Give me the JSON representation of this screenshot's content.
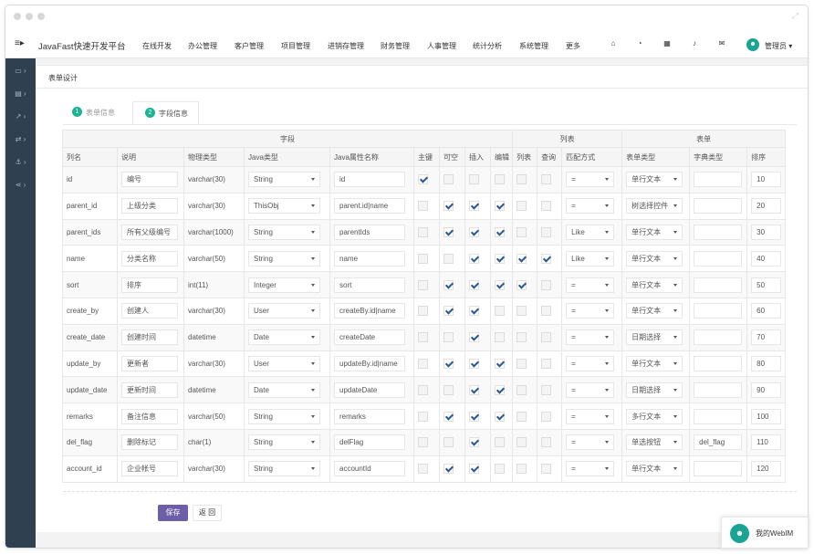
{
  "nav": {
    "brand": "JavaFast快速开发平台",
    "items": [
      "在线开发",
      "办公管理",
      "客户管理",
      "项目管理",
      "进销存管理",
      "财务管理",
      "人事管理",
      "统计分析",
      "系统管理",
      "更多"
    ],
    "icons": [
      "home-icon",
      "dashboard-icon",
      "calendar-icon",
      "bell-icon",
      "mail-icon"
    ],
    "user": "管理员 ▾",
    "user_avatar": "☻"
  },
  "sidebar": {
    "icons": [
      "monitor-icon",
      "document-icon",
      "chart-icon",
      "exchange-icon",
      "anchor-icon",
      "share-icon"
    ]
  },
  "page": {
    "title": "表单设计",
    "tabs": [
      {
        "num": "1",
        "label": "表单信息"
      },
      {
        "num": "2",
        "label": "字段信息"
      }
    ],
    "save_label": "保存",
    "back_label": "返 回"
  },
  "grid": {
    "group_headers": {
      "field": "字段",
      "list": "列表",
      "form": "表单"
    },
    "columns": [
      "列名",
      "说明",
      "物理类型",
      "Java类型",
      "Java属性名称",
      "主键",
      "可空",
      "插入",
      "编辑",
      "列表",
      "查询",
      "匹配方式",
      "表单类型",
      "字典类型",
      "排序"
    ],
    "rows": [
      {
        "col": "id",
        "desc": "编号",
        "phys": "varchar(30)",
        "jtype": "String",
        "jprop": "id",
        "pk": true,
        "nullable": false,
        "insert": false,
        "edit": false,
        "list": false,
        "query": false,
        "match": "=",
        "ftype": "单行文本",
        "dict": "",
        "sort": "10"
      },
      {
        "col": "parent_id",
        "desc": "上级分类",
        "phys": "varchar(30)",
        "jtype": "ThisObj",
        "jprop": "parent.id|name",
        "pk": false,
        "nullable": true,
        "insert": true,
        "edit": true,
        "list": false,
        "query": false,
        "match": "=",
        "ftype": "树选择控件",
        "dict": "",
        "sort": "20"
      },
      {
        "col": "parent_ids",
        "desc": "所有父级编号",
        "phys": "varchar(1000)",
        "jtype": "String",
        "jprop": "parentIds",
        "pk": false,
        "nullable": true,
        "insert": true,
        "edit": true,
        "list": false,
        "query": false,
        "match": "Like",
        "ftype": "单行文本",
        "dict": "",
        "sort": "30"
      },
      {
        "col": "name",
        "desc": "分类名称",
        "phys": "varchar(50)",
        "jtype": "String",
        "jprop": "name",
        "pk": false,
        "nullable": false,
        "insert": true,
        "edit": true,
        "list": true,
        "query": true,
        "match": "Like",
        "ftype": "单行文本",
        "dict": "",
        "sort": "40"
      },
      {
        "col": "sort",
        "desc": "排序",
        "phys": "int(11)",
        "jtype": "Integer",
        "jprop": "sort",
        "pk": false,
        "nullable": true,
        "insert": true,
        "edit": true,
        "list": true,
        "query": false,
        "match": "=",
        "ftype": "单行文本",
        "dict": "",
        "sort": "50"
      },
      {
        "col": "create_by",
        "desc": "创建人",
        "phys": "varchar(30)",
        "jtype": "User",
        "jprop": "createBy.id|name",
        "pk": false,
        "nullable": true,
        "insert": true,
        "edit": false,
        "list": false,
        "query": false,
        "match": "=",
        "ftype": "单行文本",
        "dict": "",
        "sort": "60"
      },
      {
        "col": "create_date",
        "desc": "创建时间",
        "phys": "datetime",
        "jtype": "Date",
        "jprop": "createDate",
        "pk": false,
        "nullable": false,
        "insert": true,
        "edit": false,
        "list": false,
        "query": false,
        "match": "=",
        "ftype": "日期选择",
        "dict": "",
        "sort": "70"
      },
      {
        "col": "update_by",
        "desc": "更新者",
        "phys": "varchar(30)",
        "jtype": "User",
        "jprop": "updateBy.id|name",
        "pk": false,
        "nullable": true,
        "insert": true,
        "edit": true,
        "list": false,
        "query": false,
        "match": "=",
        "ftype": "单行文本",
        "dict": "",
        "sort": "80"
      },
      {
        "col": "update_date",
        "desc": "更新时间",
        "phys": "datetime",
        "jtype": "Date",
        "jprop": "updateDate",
        "pk": false,
        "nullable": false,
        "insert": true,
        "edit": true,
        "list": false,
        "query": false,
        "match": "=",
        "ftype": "日期选择",
        "dict": "",
        "sort": "90"
      },
      {
        "col": "remarks",
        "desc": "备注信息",
        "phys": "varchar(50)",
        "jtype": "String",
        "jprop": "remarks",
        "pk": false,
        "nullable": true,
        "insert": true,
        "edit": true,
        "list": false,
        "query": false,
        "match": "=",
        "ftype": "多行文本",
        "dict": "",
        "sort": "100"
      },
      {
        "col": "del_flag",
        "desc": "删除标记",
        "phys": "char(1)",
        "jtype": "String",
        "jprop": "delFlag",
        "pk": false,
        "nullable": false,
        "insert": true,
        "edit": false,
        "list": false,
        "query": false,
        "match": "=",
        "ftype": "单选按钮",
        "dict": "del_flag",
        "sort": "110"
      },
      {
        "col": "account_id",
        "desc": "企业帐号",
        "phys": "varchar(30)",
        "jtype": "String",
        "jprop": "accountId",
        "pk": false,
        "nullable": true,
        "insert": true,
        "edit": false,
        "list": false,
        "query": false,
        "match": "=",
        "ftype": "单行文本",
        "dict": "",
        "sort": "120"
      }
    ]
  },
  "webim": {
    "label": "我的WebIM",
    "avatar": "☻"
  },
  "colors": {
    "sidebar": "#2f4050",
    "accent": "#1ab394",
    "save_button": "#6c5fa8",
    "check": "#2b5797"
  }
}
